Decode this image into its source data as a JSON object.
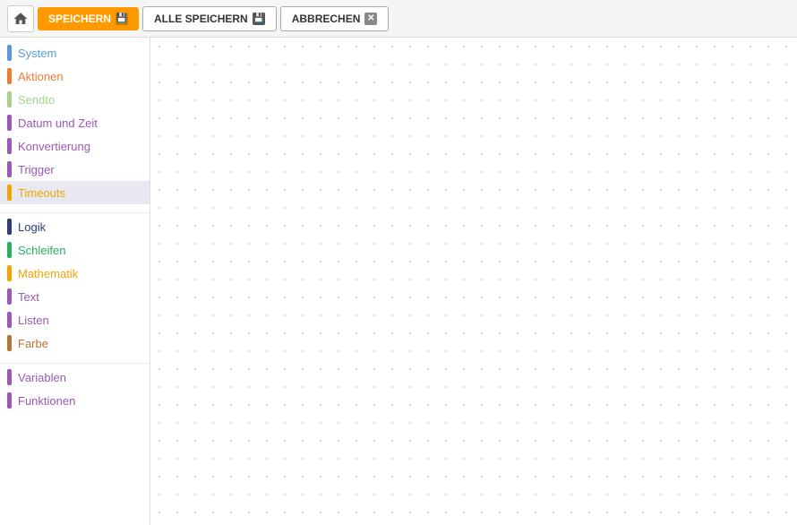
{
  "toolbar": {
    "save_label": "SPEICHERN",
    "save_all_label": "ALLE SPEICHERN",
    "cancel_label": "ABBRECHEN"
  },
  "sidebar": {
    "groups": [
      {
        "items": [
          {
            "id": "system",
            "label": "System",
            "color": "#5b9bd5"
          },
          {
            "id": "aktionen",
            "label": "Aktionen",
            "color": "#ed7d31"
          },
          {
            "id": "sendto",
            "label": "Sendto",
            "color": "#a9d18e"
          },
          {
            "id": "datum",
            "label": "Datum und Zeit",
            "color": "#9b59b6"
          },
          {
            "id": "konvertierung",
            "label": "Konvertierung",
            "color": "#9b59b6"
          },
          {
            "id": "trigger",
            "label": "Trigger",
            "color": "#9b59b6"
          },
          {
            "id": "timeouts",
            "label": "Timeouts",
            "color": "#f0a500",
            "active": true
          }
        ]
      },
      {
        "items": [
          {
            "id": "logik",
            "label": "Logik",
            "color": "#2c3e7a"
          },
          {
            "id": "schleifen",
            "label": "Schleifen",
            "color": "#27ae60"
          },
          {
            "id": "mathematik",
            "label": "Mathematik",
            "color": "#f0a500"
          },
          {
            "id": "text",
            "label": "Text",
            "color": "#9b59b6"
          },
          {
            "id": "listen",
            "label": "Listen",
            "color": "#9b59b6"
          },
          {
            "id": "farbe",
            "label": "Farbe",
            "color": "#b87333"
          }
        ]
      },
      {
        "items": [
          {
            "id": "variablen",
            "label": "Variablen",
            "color": "#9b59b6"
          },
          {
            "id": "funktionen",
            "label": "Funktionen",
            "color": "#9b59b6"
          }
        ]
      }
    ]
  }
}
